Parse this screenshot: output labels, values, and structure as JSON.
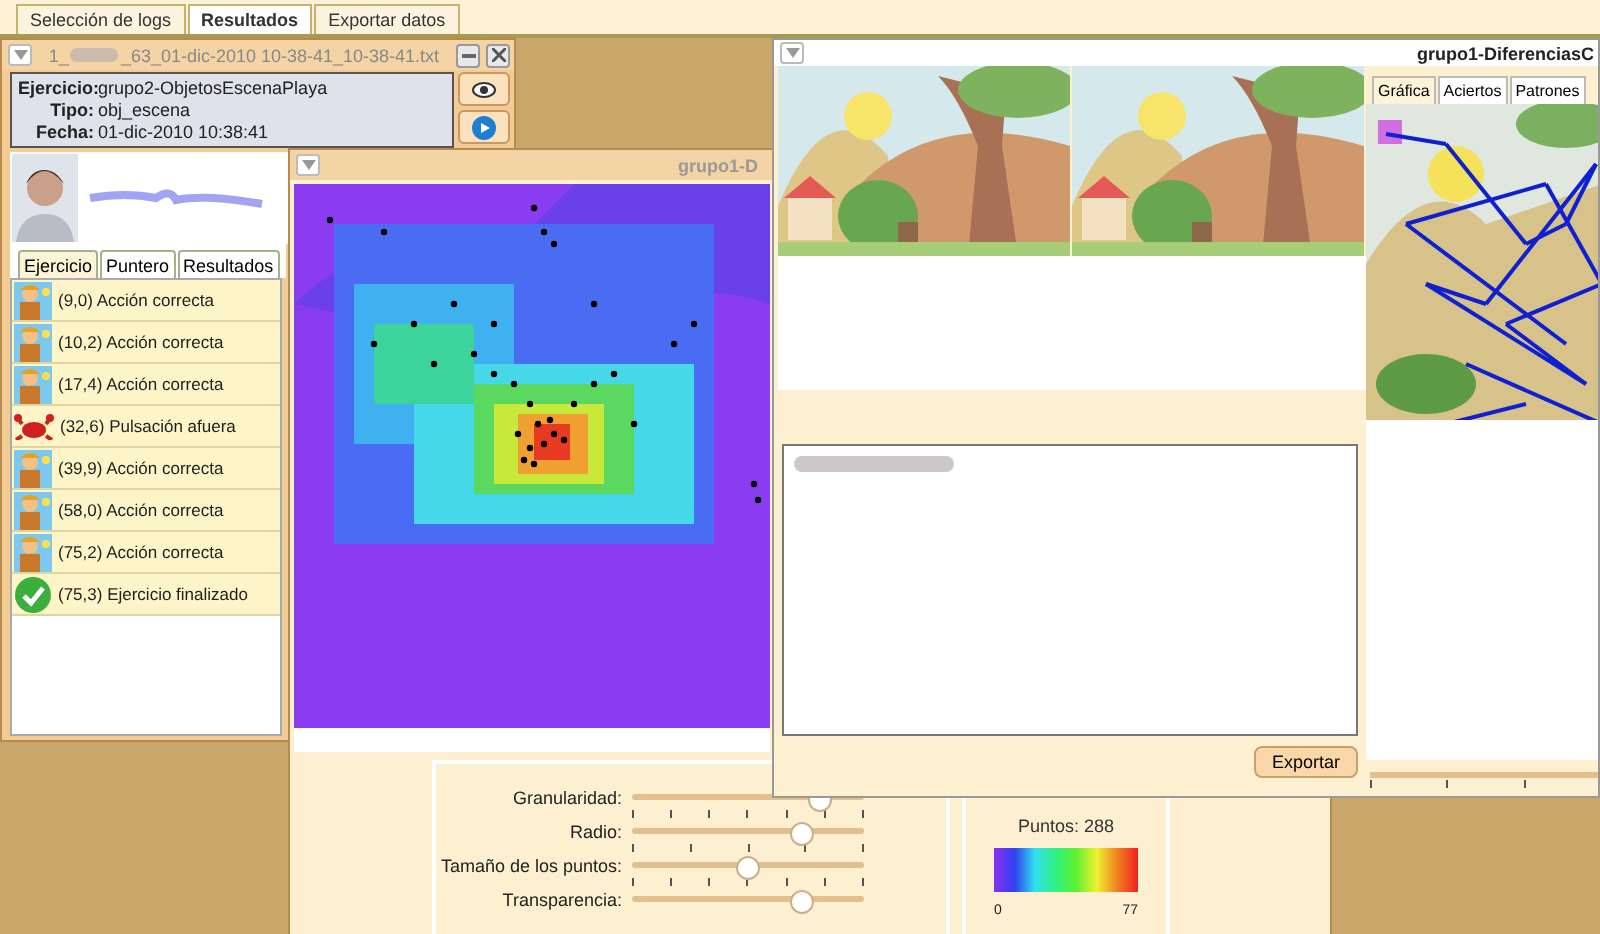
{
  "top_tabs": [
    {
      "label": "Selección de logs",
      "selected": false
    },
    {
      "label": "Resultados",
      "selected": true
    },
    {
      "label": "Exportar datos",
      "selected": false
    }
  ],
  "log_window": {
    "title_prefix": "1_",
    "title_suffix": "_63_01-dic-2010 10-38-41_10-38-41.txt",
    "info": [
      {
        "label": "Ejercicio:",
        "value": "grupo2-ObjetosEscenaPlaya"
      },
      {
        "label": "Tipo:",
        "value": "obj_escena"
      },
      {
        "label": "Fecha:",
        "value": "01-dic-2010 10:38:41"
      }
    ],
    "tabs": [
      {
        "label": "Ejercicio",
        "selected": true
      },
      {
        "label": "Puntero",
        "selected": false
      },
      {
        "label": "Resultados",
        "selected": false
      }
    ],
    "events": [
      {
        "kind": "correct",
        "text": "(9,0) Acción correcta"
      },
      {
        "kind": "correct",
        "text": "(10,2) Acción correcta"
      },
      {
        "kind": "correct",
        "text": "(17,4) Acción correcta"
      },
      {
        "kind": "miss",
        "text": "(32,6) Pulsación afuera"
      },
      {
        "kind": "correct",
        "text": "(39,9) Acción correcta"
      },
      {
        "kind": "correct",
        "text": "(58,0) Acción correcta"
      },
      {
        "kind": "correct",
        "text": "(75,2) Acción correcta"
      },
      {
        "kind": "finished",
        "text": "(75,3) Ejercicio finalizado"
      }
    ]
  },
  "heatmap_window": {
    "title": "grupo1-D",
    "sliders": [
      {
        "label": "Granularidad:",
        "level": 0.8
      },
      {
        "label": "Radio:",
        "level": 0.72
      },
      {
        "label": "Tamaño de los puntos:",
        "level": 0.49
      },
      {
        "label": "Transparencia:",
        "level": 0.72
      }
    ],
    "points": "Puntos: 288",
    "legend_min": "0",
    "legend_max": "77"
  },
  "diff_window": {
    "title": "grupo1-DiferenciasC",
    "tabs": [
      {
        "label": "Gráfica",
        "selected": true
      },
      {
        "label": "Aciertos",
        "selected": false
      },
      {
        "label": "Patrones",
        "selected": false
      }
    ],
    "export_button": "Exportar"
  }
}
